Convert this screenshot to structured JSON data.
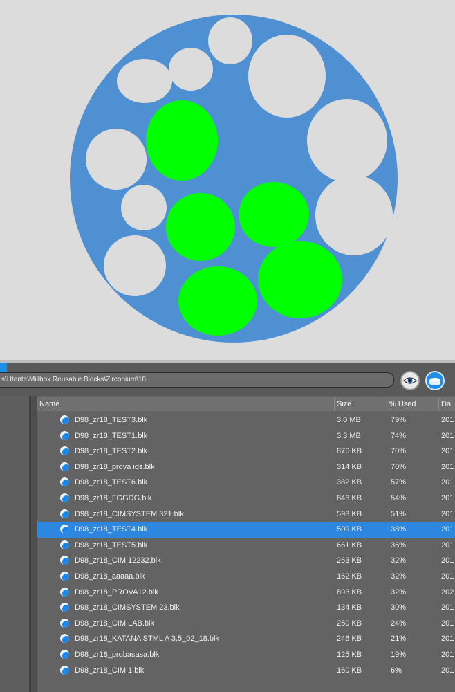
{
  "preview": {
    "disc_color": "#4f90d2",
    "used_color": "#00ff00",
    "free_color": "#dcdcdc"
  },
  "path_text": "s\\Utente\\Millbox Reusable Blocks\\Zirconium\\18",
  "icons": {
    "eye": "eye-icon",
    "disk": "disk-icon"
  },
  "columns": {
    "name": "Name",
    "size": "Size",
    "used": "% Used",
    "date": "Da"
  },
  "files": [
    {
      "name": "D98_zr18_TEST3.blk",
      "size": "3.0 MB",
      "used": "79%",
      "date": "201"
    },
    {
      "name": "D98_zr18_TEST1.blk",
      "size": "3.3 MB",
      "used": "74%",
      "date": "201"
    },
    {
      "name": "D98_zr18_TEST2.blk",
      "size": "876 KB",
      "used": "70%",
      "date": "201"
    },
    {
      "name": "D98_zr18_prova ids.blk",
      "size": "314 KB",
      "used": "70%",
      "date": "201"
    },
    {
      "name": "D98_zr18_TEST6.blk",
      "size": "382 KB",
      "used": "57%",
      "date": "201"
    },
    {
      "name": "D98_zr18_FGGDG.blk",
      "size": "843 KB",
      "used": "54%",
      "date": "201"
    },
    {
      "name": "D98_zr18_CIMSYSTEM 321.blk",
      "size": "593 KB",
      "used": "51%",
      "date": "201"
    },
    {
      "name": "D98_zr18_TEST4.blk",
      "size": "509 KB",
      "used": "38%",
      "date": "201",
      "selected": true
    },
    {
      "name": "D98_zr18_TEST5.blk",
      "size": "661 KB",
      "used": "36%",
      "date": "201"
    },
    {
      "name": "D98_zr18_CIM 12232.blk",
      "size": "263 KB",
      "used": "32%",
      "date": "201"
    },
    {
      "name": "D98_zr18_aaaaa.blk",
      "size": "162 KB",
      "used": "32%",
      "date": "201"
    },
    {
      "name": "D98_zr18_PROVA12.blk",
      "size": "893 KB",
      "used": "32%",
      "date": "202"
    },
    {
      "name": "D98_zr18_CIMSYSTEM 23.blk",
      "size": "134 KB",
      "used": "30%",
      "date": "201"
    },
    {
      "name": "D98_zr18_CIM LAB.blk",
      "size": "250 KB",
      "used": "24%",
      "date": "201"
    },
    {
      "name": "D98_zr18_KATANA STML A 3,5_02_18.blk",
      "size": "246 KB",
      "used": "21%",
      "date": "201"
    },
    {
      "name": "D98_zr18_probasasa.blk",
      "size": "125 KB",
      "used": "19%",
      "date": "201"
    },
    {
      "name": "D98_zr18_CIM 1.blk",
      "size": "160 KB",
      "used": "6%",
      "date": "201"
    }
  ]
}
